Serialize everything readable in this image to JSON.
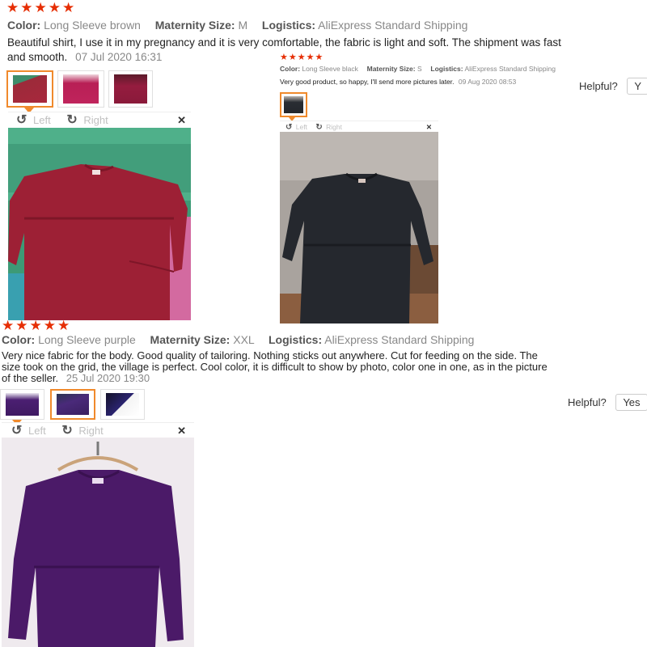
{
  "reviews": [
    {
      "stars": "★★★★★",
      "color_key": "Color:",
      "color_value": "Long Sleeve brown",
      "size_key": "Maternity Size:",
      "size_value": "M",
      "logistics_key": "Logistics:",
      "logistics_value": "AliExpress Standard Shipping",
      "text_line1": "Beautiful shirt, I use it in my pregnancy and it is very comfortable, the fabric is light and soft. The shipment was fast",
      "text_line2": "and smooth.",
      "date": "07 Jul 2020 16:31",
      "viewer_left": "Left",
      "viewer_right": "Right"
    },
    {
      "stars": "★★★★★",
      "color_key": "Color:",
      "color_value": "Long Sleeve black",
      "size_key": "Maternity Size:",
      "size_value": "S",
      "logistics_key": "Logistics:",
      "logistics_value": "AliExpress Standard Shipping",
      "text": "Very good product, so happy, I'll send more pictures later.",
      "date": "09 Aug 2020 08:53",
      "helpful_label": "Helpful?",
      "helpful_yes": "Y",
      "viewer_left": "Left",
      "viewer_right": "Right"
    },
    {
      "stars": "★★★★★",
      "color_key": "Color:",
      "color_value": "Long Sleeve purple",
      "size_key": "Maternity Size:",
      "size_value": "XXL",
      "logistics_key": "Logistics:",
      "logistics_value": "AliExpress Standard Shipping",
      "text_line1": "Very nice fabric for the body. Good quality of tailoring. Nothing sticks out anywhere. Cut for feeding on the side. The",
      "text_line2": "size took on the grid, the village is perfect. Cool color, it is difficult to show by photo, color one in one, as in the picture",
      "text_line3": "of the seller.",
      "date": "25 Jul 2020 19:30",
      "helpful_label": "Helpful?",
      "helpful_yes": "Yes",
      "viewer_left": "Left",
      "viewer_right": "Right"
    }
  ],
  "icons": {
    "rotate_left": "↺",
    "rotate_right": "↻",
    "close": "✕"
  },
  "colors": {
    "star": "#e62e04",
    "selected_border": "#f08a2c"
  }
}
